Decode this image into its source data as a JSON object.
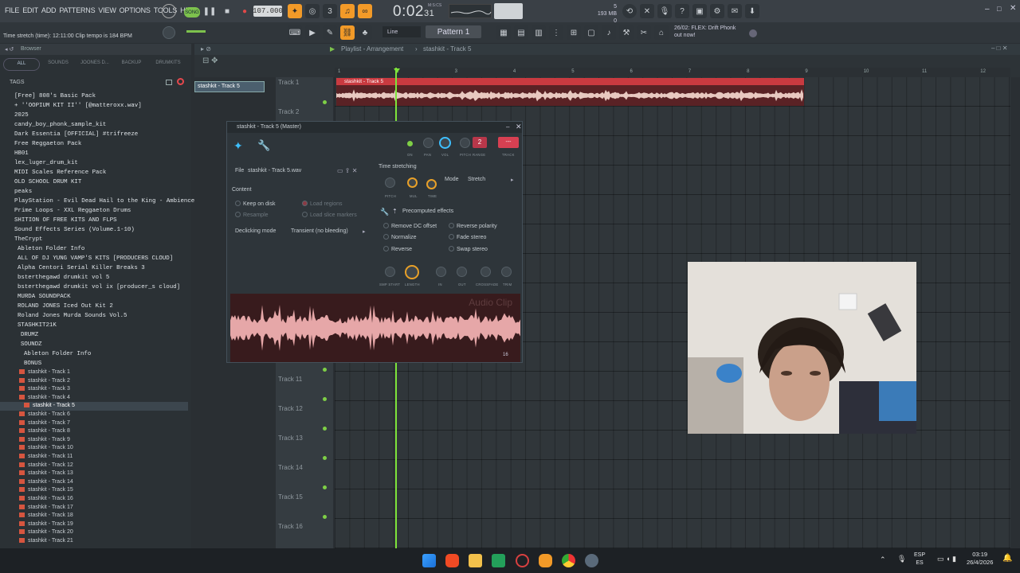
{
  "menu": [
    "FILE",
    "EDIT",
    "ADD",
    "PATTERNS",
    "VIEW",
    "OPTIONS",
    "TOOLS",
    "HELP"
  ],
  "transport": {
    "song_label": "SONG",
    "tempo": "107.000",
    "time": "0:02",
    "time_sub": "31",
    "time_unit": "M:S:CS"
  },
  "memory": {
    "line1": "5",
    "line2": "193 MB",
    "line3": "0"
  },
  "hint": "Time stretch (time): 12:11:00 Clip tempo is 184 BPM",
  "toolbar": {
    "snap": "Line",
    "pattern": "Pattern 1"
  },
  "news": {
    "line1": "26/02: FLEX: Drift Phonk",
    "line2": "out now!"
  },
  "browser": {
    "title": "Browser",
    "tabs": [
      "ALL",
      "SOUNDS",
      "JOONES D...",
      "BACKUP",
      "DRUMKITS"
    ],
    "tags_label": "TAGS",
    "folders": [
      "[Free] 808's Basic Pack",
      "+ ''OOPIUM KIT II'' [@matteroxx.wav]",
      "2025",
      "candy_boy_phonk_sample_kit",
      "Dark Essentia [OFFICIAL] #trifreeze",
      "Free Reggaeton Pack",
      "HB01",
      "lex_luger_drum_kit",
      "MIDI Scales Reference Pack",
      "OLD SCHOOL DRUM KIT",
      "peaks",
      "PlayStation - Evil Dead Hail to the King - Ambience",
      "Prime Loops - XXL Reggaeton Drums",
      "SHITION OF FREE KITS AND FLPS",
      "Sound Effects Series (Volume.1-10)",
      "TheCrypt",
      " Ableton Folder Info",
      " ALL OF DJ YUNG VAMP'S KITS [PRODUCERS CLOUD]",
      " Alpha Centori Serial Killer Breaks 3",
      " bsterthegawd drumkit vol 5",
      " bsterthegawd drumkit vol ix [producer_s cloud]",
      " MURDA SOUNDPACK",
      " ROLAND JONES Iced Out Kit 2",
      " Roland Jones Murda Sounds Vol.5",
      " STASHKIT21K",
      "  DRUMZ",
      "  SOUNDZ",
      "   Ableton Folder Info",
      "   BONUS"
    ],
    "tracks": [
      "stashkit - Track 1",
      "stashkit - Track 2",
      "stashkit - Track 3",
      "stashkit - Track 4",
      "stashkit - Track 5",
      "stashkit - Track 6",
      "stashkit - Track 7",
      "stashkit - Track 8",
      "stashkit - Track 9",
      "stashkit - Track 10",
      "stashkit - Track 11",
      "stashkit - Track 12",
      "stashkit - Track 13",
      "stashkit - Track 14",
      "stashkit - Track 15",
      "stashkit - Track 16",
      "stashkit - Track 17",
      "stashkit - Track 18",
      "stashkit - Track 19",
      "stashkit - Track 20",
      "stashkit - Track 21"
    ]
  },
  "playlist": {
    "title": "Playlist - Arrangement",
    "arrow": "›",
    "clip_name": "stashkit - Track 5",
    "channel": "stashkit - Track 5",
    "track_names": [
      "Track 1",
      "Track 2",
      "Track 11",
      "Track 12",
      "Track 13",
      "Track 14",
      "Track 15",
      "Track 16"
    ],
    "ruler": [
      "1",
      "2",
      "3",
      "4",
      "5",
      "6",
      "7",
      "8",
      "9",
      "10",
      "11",
      "12"
    ]
  },
  "clip_window": {
    "title": "stashkit - Track 5 (Master)",
    "file_label": "File",
    "file_name": "stashkit - Track 5.wav",
    "content": "Content",
    "keep_on_disk": "Keep on disk",
    "resample": "Resample",
    "load_regions": "Load regions",
    "load_slice": "Load slice markers",
    "declick_label": "Declicking mode",
    "declick_value": "Transient (no bleeding)",
    "knob_labels": {
      "on": "ON",
      "pan": "PAN",
      "vol": "VOL",
      "pitch": "PITCH",
      "range": "RANGE",
      "track": "TRACK",
      "range_val": "2",
      "track_val": "---"
    },
    "ts_title": "Time stretching",
    "ts_pitch": "PITCH",
    "ts_mul": "MUL",
    "ts_time": "TIME",
    "mode_label": "Mode",
    "mode_value": "Stretch",
    "pre_title": "Precomputed effects",
    "effects": [
      "Remove DC offset",
      "Normalize",
      "Reverse",
      "Reverse polarity",
      "Fade stereo",
      "Swap stereo"
    ],
    "knobs2": [
      "SMP START",
      "LENGTH",
      "IN",
      "OUT",
      "CROSSFADE",
      "TRIM"
    ],
    "wave_label": "Audio Clip",
    "bits": "16"
  },
  "taskbar": {
    "lang1": "ESP",
    "lang2": "ES",
    "time": "03:19",
    "date": "26/4/2026"
  }
}
